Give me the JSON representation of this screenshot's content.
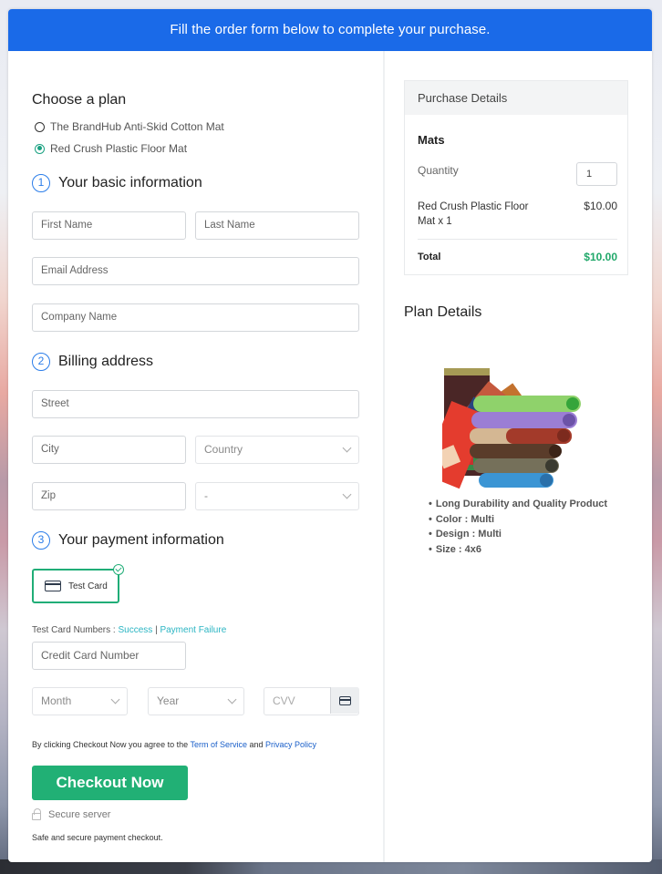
{
  "banner": {
    "text": "Fill the order form below to complete your purchase."
  },
  "plan": {
    "heading": "Choose a plan",
    "options": [
      {
        "label": "The BrandHub Anti-Skid Cotton Mat",
        "selected": false
      },
      {
        "label": "Red Crush Plastic Floor Mat",
        "selected": true
      }
    ]
  },
  "basic_info": {
    "number": "1",
    "title": "Your basic information",
    "first_name_placeholder": "First Name",
    "last_name_placeholder": "Last Name",
    "email_placeholder": "Email Address",
    "company_placeholder": "Company Name"
  },
  "billing": {
    "number": "2",
    "title": "Billing address",
    "street_placeholder": "Street",
    "city_placeholder": "City",
    "country_selected": "Country",
    "zip_placeholder": "Zip",
    "state_selected": "-"
  },
  "payment": {
    "number": "3",
    "title": "Your payment information",
    "method_label": "Test Card",
    "test_numbers_label": "Test Card Numbers :",
    "success_link": "Success",
    "separator": "|",
    "failure_link": "Payment Failure",
    "card_number_placeholder": "Credit Card Number",
    "month_selected": "Month",
    "year_selected": "Year",
    "cvv_placeholder": "CVV"
  },
  "terms": {
    "prefix": "By clicking Checkout Now you agree to the",
    "tos_link": "Term of Service",
    "and": "and",
    "privacy_link": "Privacy Policy"
  },
  "checkout": {
    "button_label": "Checkout Now",
    "secure_label": "Secure server",
    "safe_text": "Safe and secure payment checkout."
  },
  "purchase_details": {
    "heading": "Purchase Details",
    "category": "Mats",
    "quantity_label": "Quantity",
    "quantity_value": "1",
    "item_name": "Red Crush Plastic Floor Mat x 1",
    "item_price": "$10.00",
    "total_label": "Total",
    "total_value": "$10.00"
  },
  "plan_details": {
    "heading": "Plan Details",
    "image_alt": "rolled-floor-mats-image",
    "features": [
      "Long Durability and Quality Product",
      "Color : Multi",
      "Design : Multi",
      "Size : 4x6"
    ]
  },
  "colors": {
    "banner": "#1a6ae8",
    "accent_green": "#21b075",
    "step_blue": "#2b7de9",
    "link_teal": "#2bb5c3",
    "total_green": "#21a86a"
  }
}
